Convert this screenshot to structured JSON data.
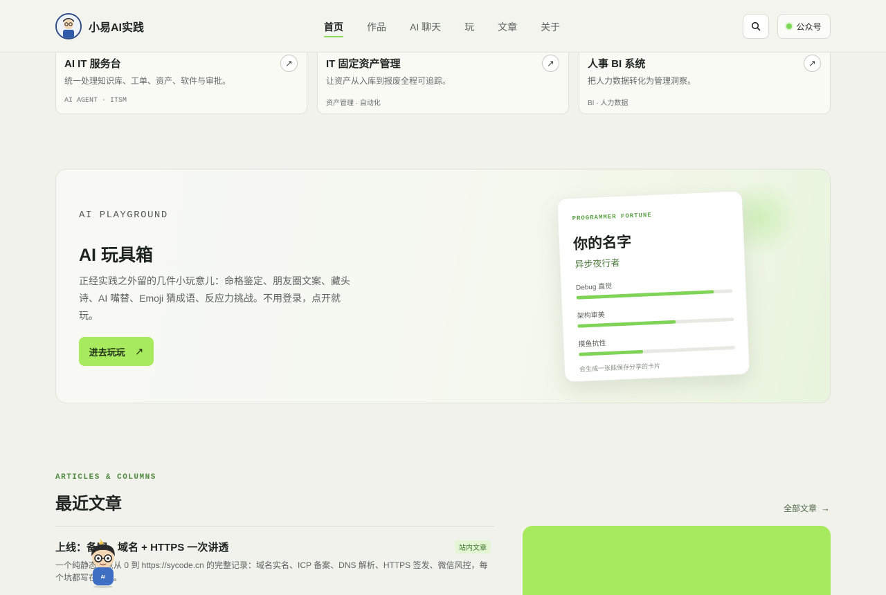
{
  "header": {
    "brand": "小易AI实践",
    "nav": [
      "首页",
      "作品",
      "AI 聊天",
      "玩",
      "文章",
      "关于"
    ],
    "active_nav": "首页",
    "wechat_label": "公众号"
  },
  "projects": [
    {
      "title": "AI IT 服务台",
      "desc": "统一处理知识库、工单、资产、软件与审批。",
      "tags": "AI AGENT  ·  ITSM"
    },
    {
      "title": "IT 固定资产管理",
      "desc": "让资产从入库到报废全程可追踪。",
      "tags": "资产管理  ·  自动化"
    },
    {
      "title": "人事 BI 系统",
      "desc": "把人力数据转化为管理洞察。",
      "tags": "BI  ·  人力数据"
    }
  ],
  "playground": {
    "eyebrow": "AI PLAYGROUND",
    "title": "AI 玩具箱",
    "desc": "正经实践之外留的几件小玩意儿：命格鉴定、朋友圈文案、藏头诗、AI 嘴替、Emoji 猜成语、反应力挑战。不用登录，点开就玩。",
    "button": "进去玩玩",
    "fortune": {
      "eyebrow": "PROGRAMMER FORTUNE",
      "name": "你的名字",
      "subtitle": "异步夜行者",
      "stats": [
        {
          "label": "Debug 直觉",
          "value": 0.88
        },
        {
          "label": "架构审美",
          "value": 0.63
        },
        {
          "label": "摸鱼抗性",
          "value": 0.41
        }
      ],
      "note": "会生成一张能保存分享的卡片"
    }
  },
  "articles": {
    "eyebrow": "ARTICLES & COLUMNS",
    "title": "最近文章",
    "all_link": "全部文章",
    "post": {
      "title": "上线：备案、域名 + HTTPS 一次讲透",
      "badge": "站内文章",
      "desc": "一个纯静态站点从 0 到 https://sycode.cn 的完整记录：域名实名、ICP 备案、DNS 解析、HTTPS 签发、微信风控，每个坑都写在这里。"
    }
  },
  "colors": {
    "accent": "#a8ea5e",
    "accent_dark": "#7fd356",
    "background": "#f2f2ec"
  }
}
